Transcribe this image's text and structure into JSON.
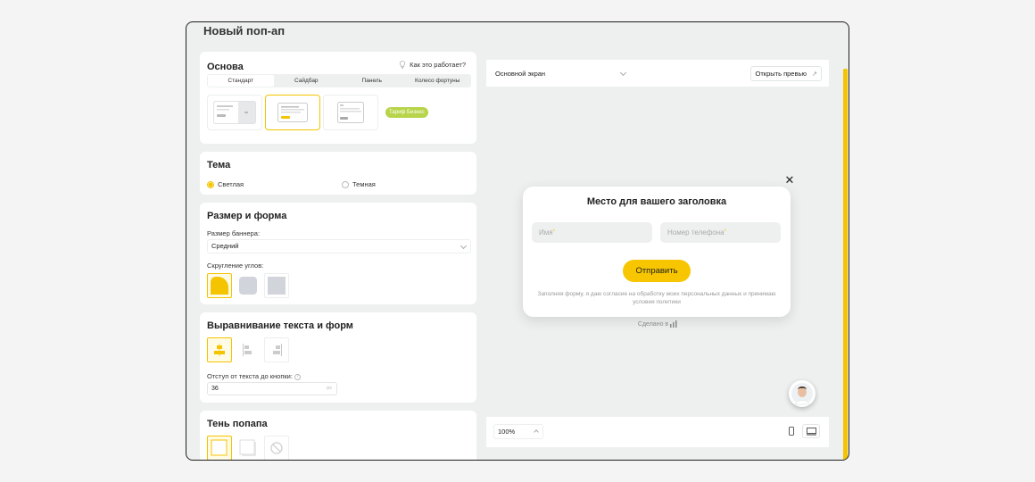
{
  "page": {
    "title": "Новый поп-ап"
  },
  "osnova": {
    "title": "Основа",
    "howto": "Как это работает?",
    "tabs": [
      "Стандарт",
      "Сайдбар",
      "Панель",
      "Колесо фортуны"
    ],
    "badge": "Тариф Бизнес"
  },
  "theme": {
    "title": "Тема",
    "light": "Светлая",
    "dark": "Темная",
    "selected": "light"
  },
  "size": {
    "title": "Размер и форма",
    "banner_label": "Размер баннера:",
    "banner_value": "Средний",
    "corners_label": "Скругление углов:"
  },
  "align": {
    "title": "Выравнивание текста и форм",
    "offset_label": "Отступ от текста до кнопки:",
    "offset_value": "36",
    "offset_unit": "px"
  },
  "shadow": {
    "title": "Тень попапа"
  },
  "preview": {
    "screen_select": "Основной экран",
    "open_preview": "Открыть превью",
    "zoom": "100%",
    "popup": {
      "title": "Место для вашего заголовка",
      "name_placeholder": "Имя",
      "phone_placeholder": "Номер телефона",
      "submit": "Отправить",
      "consent": "Заполняя форму, я даю согласие на обработку моих персональных данных и принимаю условия политики"
    },
    "made_by": "Сделано в"
  },
  "colors": {
    "accent": "#f4c400",
    "button": "#f7c600",
    "badge": "#b7d44a"
  }
}
